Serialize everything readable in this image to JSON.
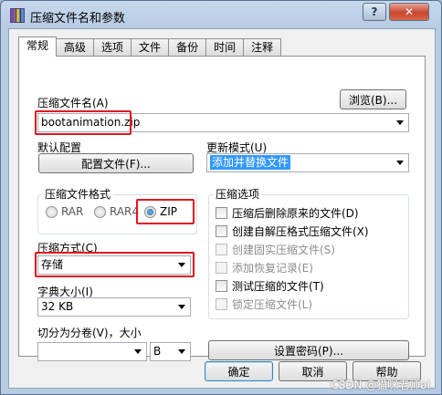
{
  "window": {
    "title": "压缩文件名和参数",
    "help_glyph": "?",
    "close_glyph": "✕",
    "icon": "winrar-icon"
  },
  "tabs": [
    "常规",
    "高级",
    "选项",
    "文件",
    "备份",
    "时间",
    "注释"
  ],
  "general": {
    "archive_name_label": "压缩文件名(A)",
    "browse_button": "浏览(B)...",
    "archive_name_value": "bootanimation.zip",
    "default_profile_label": "默认配置",
    "profile_button": "配置文件(F)...",
    "update_mode_label": "更新模式(U)",
    "update_mode_value": "添加并替换文件",
    "format_group_title": "压缩文件格式",
    "formats": [
      {
        "label": "RAR",
        "checked": false
      },
      {
        "label": "RAR4",
        "checked": false
      },
      {
        "label": "ZIP",
        "checked": true
      }
    ],
    "method_label": "压缩方式(C)",
    "method_value": "存储",
    "dict_label": "字典大小(I)",
    "dict_value": "32 KB",
    "split_label": "切分为分卷(V)，大小",
    "split_value": "",
    "split_unit": "B",
    "options_group_title": "压缩选项",
    "options": [
      {
        "label": "压缩后删除原来的文件(D)",
        "checked": false,
        "enabled": true
      },
      {
        "label": "创建自解压格式压缩文件(X)",
        "checked": false,
        "enabled": true
      },
      {
        "label": "创建固实压缩文件(S)",
        "checked": false,
        "enabled": false
      },
      {
        "label": "添加恢复记录(E)",
        "checked": false,
        "enabled": false
      },
      {
        "label": "测试压缩的文件(T)",
        "checked": false,
        "enabled": true
      },
      {
        "label": "锁定压缩文件(L)",
        "checked": false,
        "enabled": false
      }
    ],
    "password_button": "设置密码(P)..."
  },
  "footer": {
    "ok": "确定",
    "cancel": "取消",
    "help": "帮助"
  },
  "watermark": "CSDN @猫咪老师ai"
}
